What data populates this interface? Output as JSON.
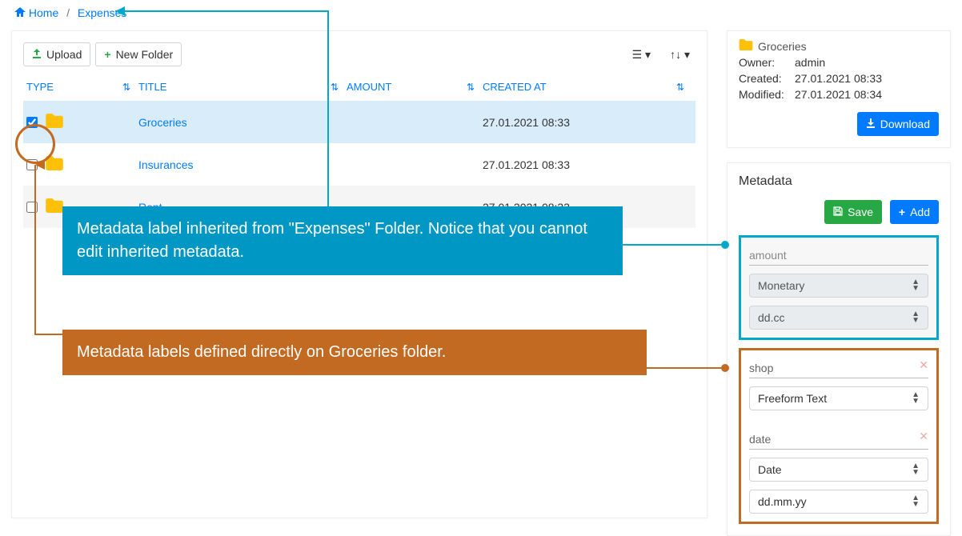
{
  "breadcrumb": {
    "home": "Home",
    "expenses": "Expenses"
  },
  "buttons": {
    "upload": "Upload",
    "new_folder": "New Folder",
    "download": "Download",
    "save": "Save",
    "add": "Add"
  },
  "columns": {
    "type": "TYPE",
    "title": "TITLE",
    "amount": "AMOUNT",
    "created": "CREATED AT"
  },
  "rows": [
    {
      "title": "Groceries",
      "created": "27.01.2021 08:33",
      "selected": true
    },
    {
      "title": "Insurances",
      "created": "27.01.2021 08:33",
      "selected": false
    },
    {
      "title": "Rent",
      "created": "27.01.2021 08:33",
      "selected": false
    }
  ],
  "info": {
    "name": "Groceries",
    "owner_label": "Owner:",
    "owner": "admin",
    "created_label": "Created:",
    "created": "27.01.2021 08:33",
    "modified_label": "Modified:",
    "modified": "27.01.2021 08:34"
  },
  "metadata_header": "Metadata",
  "meta": {
    "amount_label": "amount",
    "amount_type": "Monetary",
    "amount_format": "dd.cc",
    "shop_label": "shop",
    "shop_type": "Freeform Text",
    "date_label": "date",
    "date_type": "Date",
    "date_format": "dd.mm.yy"
  },
  "annotations": {
    "blue": "Metadata label inherited from \"Expenses\" Folder. Notice that you cannot edit inherited metadata.",
    "orange": "Metadata labels defined directly on Groceries folder."
  }
}
